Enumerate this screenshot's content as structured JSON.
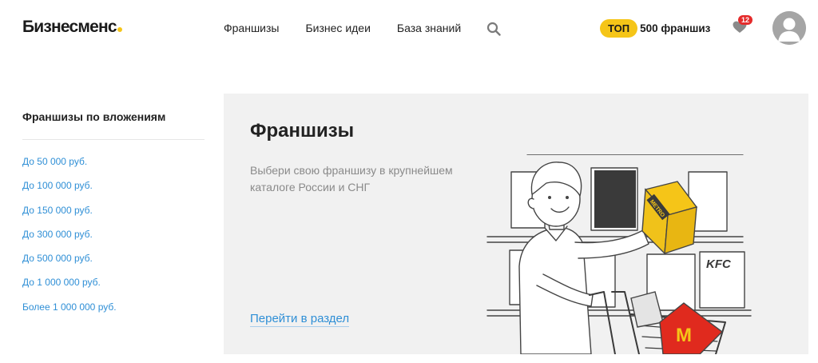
{
  "header": {
    "logo": "Бизнесменс",
    "nav": [
      "Франшизы",
      "Бизнес идеи",
      "База знаний"
    ],
    "top_pill": "ТОП",
    "top_text": "500 франшиз",
    "favorites_count": "12",
    "search_icon": "search-icon",
    "heart_icon": "heart-icon",
    "avatar_icon": "user-avatar-icon"
  },
  "sidebar": {
    "title": "Франшизы по вложениям",
    "items": [
      "До 50 000 руб.",
      "До 100 000 руб.",
      "До 150 000 руб.",
      "До 300 000 руб.",
      "До 500 000 руб.",
      "До 1 000 000 руб.",
      "Более 1 000 000 руб."
    ]
  },
  "card": {
    "title": "Франшизы",
    "description": "Выбери свою франшизу в крупнейшем каталоге России и СНГ",
    "link": "Перейти в раздел",
    "illustration_labels": {
      "box_brand": "METRO",
      "wall_logo": "KFC",
      "bag_logo": "M"
    }
  },
  "colors": {
    "accent_yellow": "#f5c518",
    "link_blue": "#2f8fd6",
    "badge_red": "#e52b2b",
    "card_bg": "#f1f1f1"
  }
}
